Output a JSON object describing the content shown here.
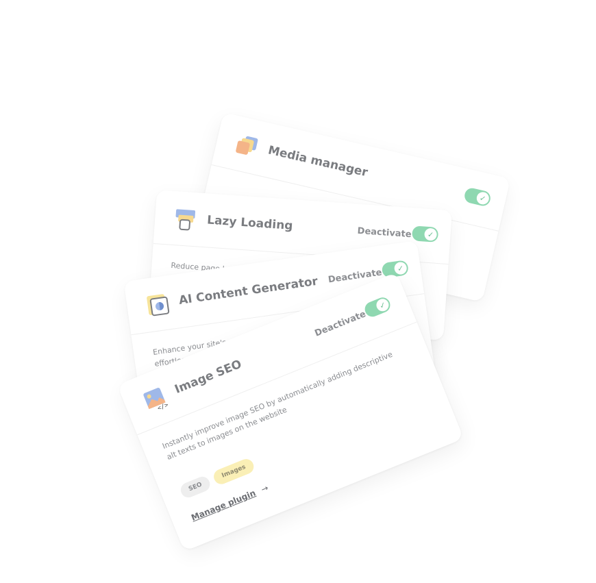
{
  "cards": {
    "media_manager": {
      "title": "Media manager",
      "toggle_check": "✓"
    },
    "lazy_loading": {
      "title": "Lazy Loading",
      "action": "Deactivate",
      "toggle_check": "✓",
      "description": "Reduce page load ti… and larg…"
    },
    "ai_content": {
      "title": "AI Content Generator",
      "action": "Deactivate",
      "toggle_check": "✓",
      "description": "Enhance your site's content effortless… generating unique texts"
    },
    "image_seo": {
      "title": "Image SEO",
      "action": "Deactivate",
      "toggle_check": "✓",
      "description": "Instantly improve image SEO by automatically adding descriptive alt texts to images on the website",
      "tags": [
        "SEO",
        "Images"
      ],
      "manage_label": "Manage plugin",
      "manage_arrow": "→"
    }
  },
  "colors": {
    "toggle_on": "#8fd8b1",
    "tag_yellow": "#faefb6",
    "tag_gray": "#eeeeee"
  },
  "icons": {
    "media_manager": "stacked-images-icon",
    "lazy_loading": "layers-icon",
    "ai_content": "ai-document-icon",
    "image_seo": "image-code-icon"
  }
}
